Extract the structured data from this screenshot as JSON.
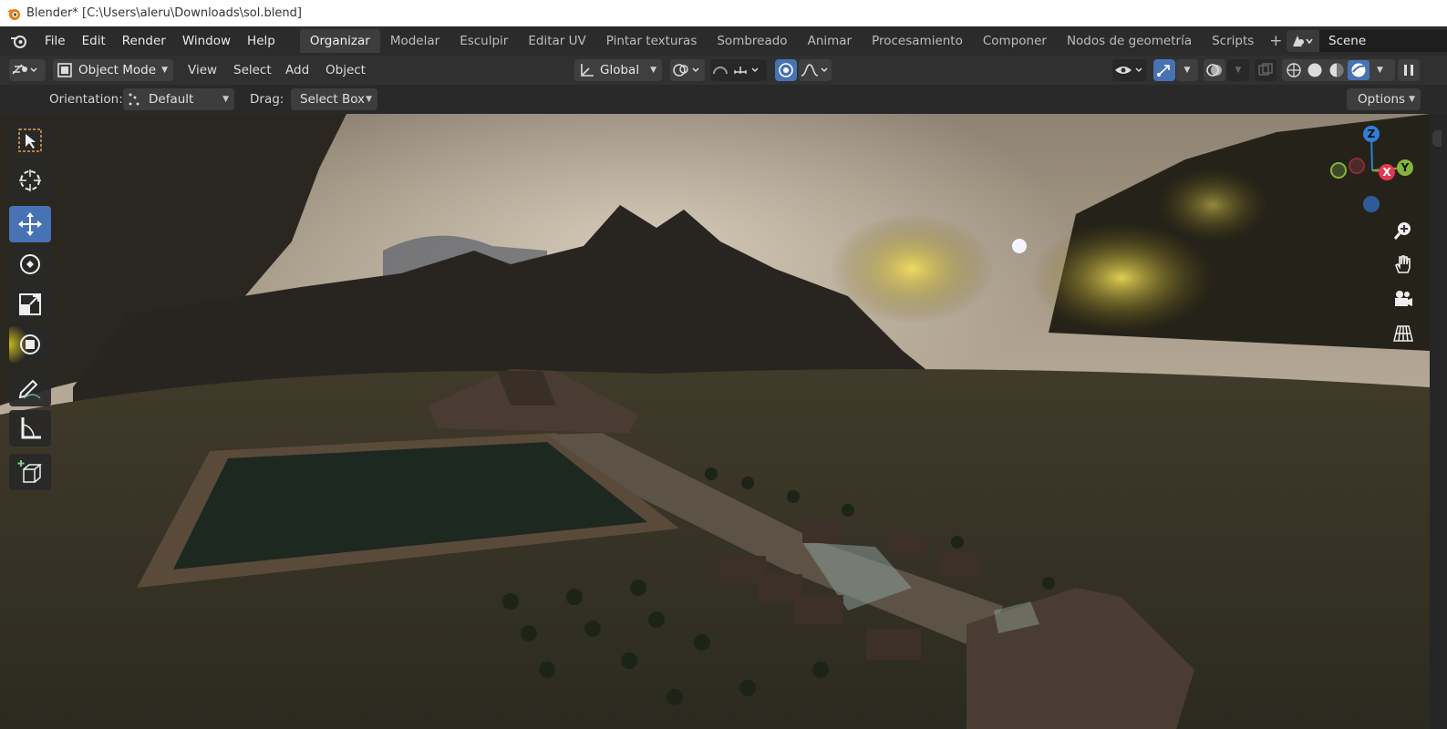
{
  "title_bar": {
    "text": "Blender* [C:\\Users\\aleru\\Downloads\\sol.blend]"
  },
  "menu": [
    "File",
    "Edit",
    "Render",
    "Window",
    "Help"
  ],
  "workspaces": [
    "Organizar",
    "Modelar",
    "Esculpir",
    "Editar UV",
    "Pintar texturas",
    "Sombreado",
    "Animar",
    "Procesamiento",
    "Componer",
    "Nodos de geometría",
    "Scripts"
  ],
  "active_workspace": "Organizar",
  "scene": {
    "name": "Scene"
  },
  "viewport_header": {
    "mode": "Object Mode",
    "menus": [
      "View",
      "Select",
      "Add",
      "Object"
    ],
    "orientation": "Global"
  },
  "tool_settings": {
    "orientation_label": "Orientation:",
    "orientation_value": "Default",
    "drag_label": "Drag:",
    "drag_value": "Select Box",
    "options": "Options"
  },
  "gizmo": {
    "z": "Z",
    "y": "Y",
    "x": "X"
  },
  "colors": {
    "accent": "#4772b3",
    "x_axis": "#e0394f",
    "y_axis": "#86b33b",
    "z_axis": "#2f7fd9"
  }
}
